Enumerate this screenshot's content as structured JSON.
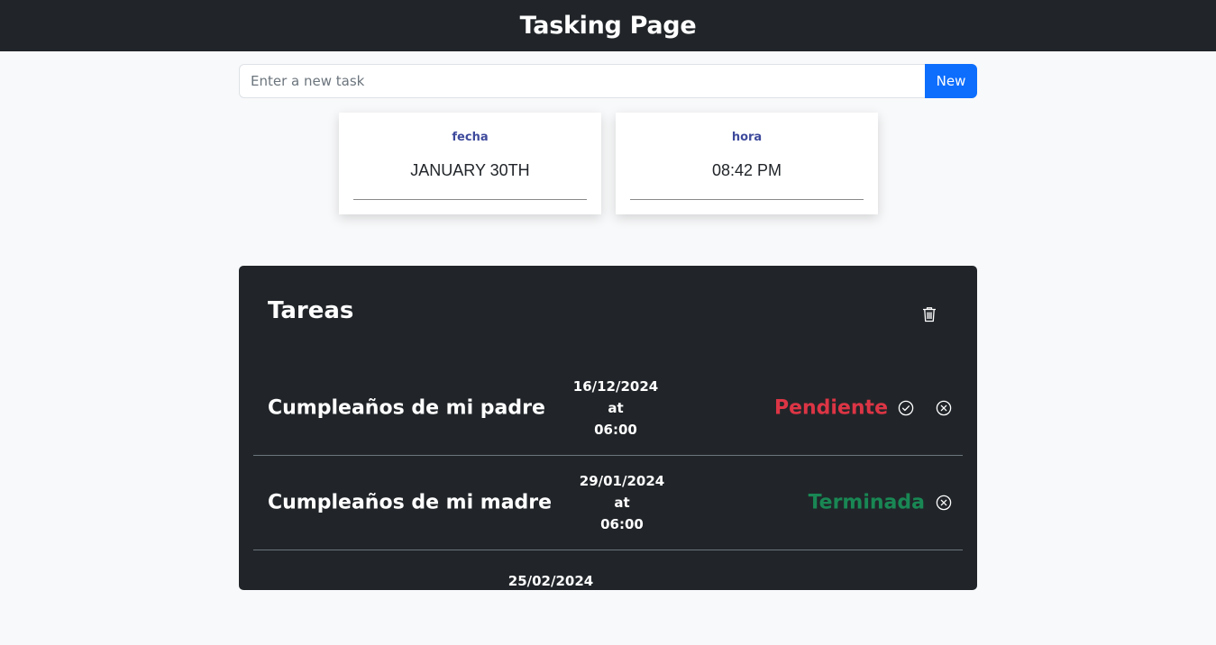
{
  "header": {
    "title": "Tasking Page"
  },
  "new_task": {
    "placeholder": "Enter a new task",
    "button_label": "New"
  },
  "info_cards": {
    "date": {
      "label": "fecha",
      "value": "JANUARY 30TH"
    },
    "time": {
      "label": "hora",
      "value": "08:42 PM"
    }
  },
  "tasks": {
    "title": "Tareas",
    "items": [
      {
        "name": "Cumpleaños de mi padre",
        "date": "16/12/2024",
        "at": "at",
        "time": "06:00",
        "status": "Pendiente",
        "status_color": "#dc3545"
      },
      {
        "name": "Cumpleaños de mi madre",
        "date": "29/01/2024",
        "at": "at",
        "time": "06:00",
        "status": "Terminada",
        "status_color": "#198754"
      },
      {
        "date": "25/02/2024"
      }
    ]
  },
  "colors": {
    "navbar": "#212529",
    "accent": "#0d6efd",
    "pending": "#dc3545",
    "done": "#198754"
  }
}
